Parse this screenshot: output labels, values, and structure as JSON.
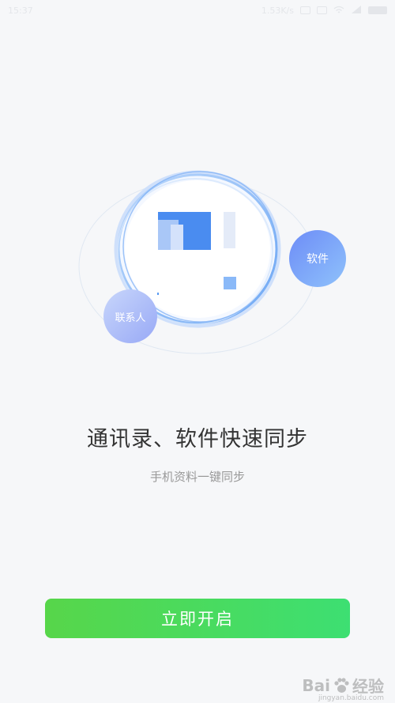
{
  "status_bar": {
    "time": "15:37",
    "network_speed": "1.53K/s"
  },
  "illustration": {
    "bubble_software": "软件",
    "bubble_contacts": "联系人"
  },
  "headline": "通讯录、软件快速同步",
  "subtitle": "手机资料一键同步",
  "start_button_label": "立即开启",
  "watermark": {
    "brand": "Bai",
    "brand_suffix": "经验",
    "url": "jingyan.baidu.com"
  },
  "colors": {
    "background": "#f6f7f9",
    "button_start": "#57d64a",
    "button_end": "#3ddf72",
    "accent_blue": "#4a8cf0",
    "headline": "#333333",
    "subtitle": "#999999"
  }
}
